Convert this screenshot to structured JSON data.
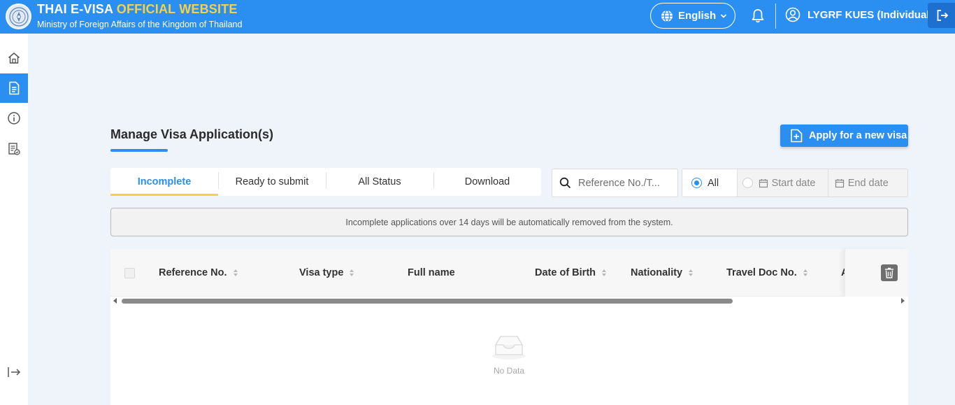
{
  "header": {
    "title_prefix": "THAI E-VISA",
    "title_accent": "OFFICIAL WEBSITE",
    "subtitle": "Ministry of Foreign Affairs of the Kingdom of Thailand",
    "language": "English",
    "user_name": "LYGRF KUES (Individual)",
    "accent_color": "#f7d04a",
    "brand_color": "#2a8ff0"
  },
  "sidebar": {
    "items": [
      {
        "icon": "home-icon",
        "active": false
      },
      {
        "icon": "document-icon",
        "active": true
      },
      {
        "icon": "info-icon",
        "active": false
      },
      {
        "icon": "checklist-icon",
        "active": false
      }
    ],
    "collapse_icon": "expand-arrow-icon"
  },
  "main": {
    "page_title": "Manage Visa Application(s)",
    "apply_button": "Apply for a new visa",
    "tabs": [
      {
        "label": "Incomplete",
        "active": true
      },
      {
        "label": "Ready to submit",
        "active": false
      },
      {
        "label": "All Status",
        "active": false
      },
      {
        "label": "Download",
        "active": false
      }
    ],
    "search_placeholder": "Reference No./T...",
    "filter": {
      "all_label": "All",
      "start_label": "Start date",
      "end_label": "End date",
      "selected": "All"
    },
    "notice": "Incomplete applications over 14 days will be automatically removed from the system.",
    "table": {
      "columns": [
        "Reference No.",
        "Visa type",
        "Full name",
        "Date of Birth",
        "Nationality",
        "Travel Doc No."
      ],
      "truncated_column_initial": "A",
      "rows": [],
      "empty_text": "No Data"
    }
  }
}
